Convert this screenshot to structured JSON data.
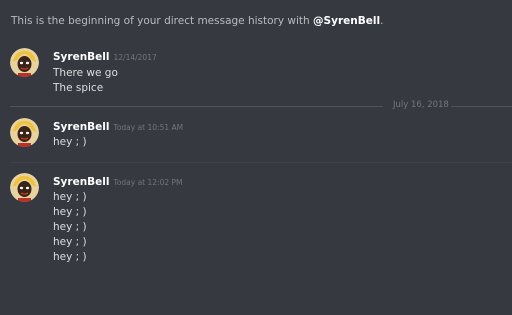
{
  "intro": {
    "prefix": "This is the beginning of your direct message history with ",
    "mention": "@SyrenBell",
    "suffix": "."
  },
  "date_divider": {
    "label": "July 16, 2018"
  },
  "groups": [
    {
      "author": "SyrenBell",
      "timestamp": "12/14/2017",
      "messages": [
        "There we go",
        "The spice"
      ]
    },
    {
      "author": "SyrenBell",
      "timestamp": "Today at 10:51 AM",
      "messages": [
        "hey ; )"
      ]
    },
    {
      "author": "SyrenBell",
      "timestamp": "Today at 12:02 PM",
      "messages": [
        "hey ; )",
        "hey ; )",
        "hey ; )",
        "hey ; )",
        "hey ; )"
      ]
    }
  ],
  "icons": {
    "avatar": "avatar-icon"
  },
  "colors": {
    "background": "#36393f",
    "username": "#ffffff",
    "message_text": "#dcddde",
    "timestamp": "#72767d",
    "divider": "#4f545c"
  }
}
